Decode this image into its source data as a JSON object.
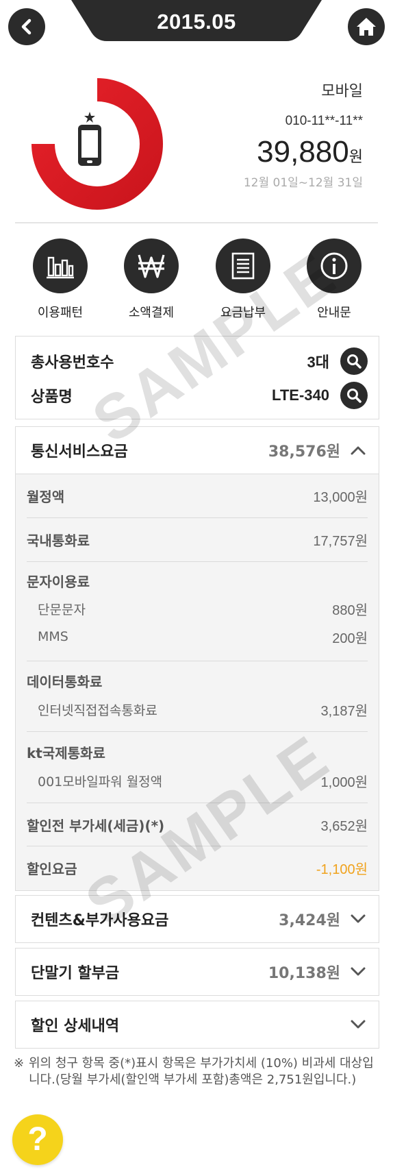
{
  "header": {
    "period": "2015.05",
    "back_icon": "back-arrow-icon",
    "home_icon": "home-icon"
  },
  "summary": {
    "service_type": "모바일",
    "phone_number": "010-11**-11**",
    "amount": "39,880",
    "amount_unit": "원",
    "bill_period": "12월 01일~12월 31일",
    "accent_color": "#d71920",
    "device_icon": "smartphone-icon"
  },
  "quick_menu": [
    {
      "label": "이용패턴",
      "icon": "bar-chart-icon"
    },
    {
      "label": "소액결제",
      "icon": "won-icon"
    },
    {
      "label": "요금납부",
      "icon": "document-icon"
    },
    {
      "label": "안내문",
      "icon": "info-icon"
    }
  ],
  "info": {
    "total_lines_label": "총사용번호수",
    "total_lines_value": "3대",
    "product_label": "상품명",
    "product_value": "LTE-340"
  },
  "telecom": {
    "title": "통신서비스요금",
    "amount": "38,576원",
    "rows": {
      "monthly_label": "월정액",
      "monthly_value": "13,000원",
      "domestic_label": "국내통화료",
      "domestic_value": "17,757원",
      "sms_label": "문자이용료",
      "short_msg_label": "단문문자",
      "short_msg_value": "880원",
      "mms_label": "MMS",
      "mms_value": "200원",
      "data_label": "데이터통화료",
      "internet_label": "인터넷직접접속통화료",
      "internet_value": "3,187원",
      "intl_label": "kt국제통화료",
      "intl_sub_label": "001모바일파워 월정액",
      "intl_sub_value": "1,000원",
      "vat_label": "할인전 부가세(세금)(*)",
      "vat_value": "3,652원",
      "discount_label": "할인요금",
      "discount_value": "-1,100원"
    }
  },
  "content_fees": {
    "title": "컨텐츠&부가사용요금",
    "amount": "3,424원"
  },
  "device_installment": {
    "title": "단말기 할부금",
    "amount": "10,138원"
  },
  "discount_detail": {
    "title": "할인 상세내역"
  },
  "footnote": {
    "mark": "※",
    "text": "위의 청구 항목 중(*)표시 항목은 부가가치세 (10%) 비과세 대상입니다.(당월 부가세(할인액 부가세 포함)총액은 2,751원입니다.)"
  },
  "watermark": "SAMPLE",
  "help": {
    "label": "?"
  },
  "colors": {
    "dark": "#2b2b2b",
    "orange": "#f0a21c",
    "yellow": "#f5d31b"
  }
}
